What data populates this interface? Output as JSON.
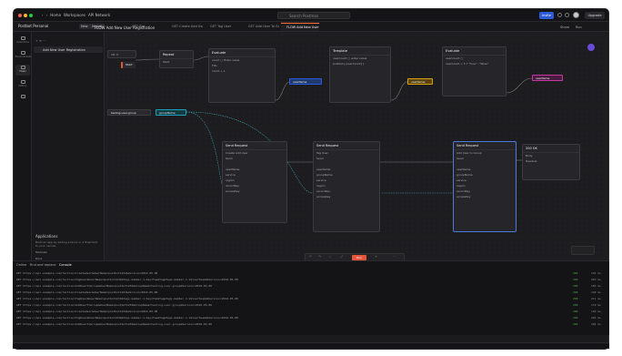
{
  "app": {
    "home": "Home",
    "workspaces": "Workspaces",
    "api_network": "API Network",
    "search_placeholder": "Search Postman",
    "invite": "Invite",
    "upgrade": "Upgrade"
  },
  "workspace": {
    "name": "Postbot Personal",
    "new": "New",
    "import": "Import"
  },
  "tabs": [
    {
      "label": "GET Get",
      "active": false
    },
    {
      "label": "GET Create Add User",
      "active": false
    },
    {
      "label": "GET Tag User",
      "active": false
    },
    {
      "label": "GET Add User To Group",
      "active": false
    },
    {
      "label": "FLOW Add New User Regi",
      "active": true
    }
  ],
  "rail": [
    "Collections",
    "Environments",
    "Flows",
    "History",
    ""
  ],
  "sidebar": {
    "item": "Add New User Registration",
    "apps_title": "Applications",
    "apps_text": "Build an app by adding a block or a flowchart to your canvas.",
    "apps_link1": "Tutorials",
    "apps_link2": "Docs"
  },
  "flow": {
    "title": "FLOW Add New User Registration",
    "share": "Share",
    "run_status": "Run",
    "zoom": "1"
  },
  "nodes": {
    "start": "Start",
    "repeat": {
      "title": "Repeat",
      "row1": "Start",
      "row2": "Start"
    },
    "evaluate1": {
      "title": "Evaluate"
    },
    "template": {
      "title": "Template"
    },
    "evaluate2": {
      "title": "Evaluate"
    },
    "testing": "testing-user-group",
    "groupName": "groupName",
    "req1": {
      "title": "Send Request",
      "sub": "Create Add User",
      "send": "Send",
      "success": "Success",
      "fail": "Fail"
    },
    "req2": {
      "title": "Send Request",
      "sub": "Tag User",
      "send": "Send",
      "success": "Success",
      "fail": "Fail"
    },
    "req3": {
      "title": "Send Request",
      "sub": "Add User to Group",
      "send": "Send",
      "success": "Success",
      "fail": "Fail"
    },
    "fields": [
      "userName",
      "groupName",
      "service",
      "region",
      "recordKey",
      "accessKey"
    ],
    "output": {
      "title": "Out",
      "status": "200 OK",
      "body": "Body",
      "headers": "Headers"
    }
  },
  "console": {
    "tabs": [
      "Online",
      "Find and replace",
      "Console"
    ],
    "logs": [
      "GET https://api.example.com/?action=CreateUser&UserName=postbot1232&Version=2010-05-08",
      "GET https://api.example.com/?action=TagUser&UserName=postbot1232&Tags.member.1.Key=TeamTag&Tags.member.1.Value=Team2&Version=2010-05-08",
      "GET https://api.example.com/?action=AddUserToGroup&UserName=postbot1232&GroupName=testing-user-group&Version=2010-05-08",
      "GET https://api.example.com/?action=CreateUser&UserName=postbot1233&Version=2010-05-08",
      "GET https://api.example.com/?action=TagUser&UserName=postbot1233&Tags.member.1.Key=TeamTag&Tags.member.1.Value=Team2&Version=2010-05-08",
      "GET https://api.example.com/?action=AddUserToGroup&UserName=postbot1233&GroupName=testing-user-group&Version=2010-05-08",
      "GET https://api.example.com/?action=CreateUser&UserName=postbot1234&Version=2010-05-08",
      "GET https://api.example.com/?action=TagUser&UserName=postbot1234&Tags.member.1.Key=TeamTag&Tags.member.1.Value=Team2&Version=2010-05-08",
      "GET https://api.example.com/?action=AddUserToGroup&UserName=postbot1234&GroupName=testing-user-group&Version=2010-05-08"
    ],
    "status": "200",
    "durations": [
      "195 ms",
      "203 ms",
      "186 ms",
      "190 ms",
      "211 ms",
      "178 ms",
      "199 ms",
      "205 ms",
      "184 ms"
    ]
  },
  "colors": {
    "accent": "#ff6c37",
    "primary": "#2e5bd8",
    "evaluate": "#d8a010",
    "output": "#c23aa0",
    "group": "#1aa0b8"
  }
}
